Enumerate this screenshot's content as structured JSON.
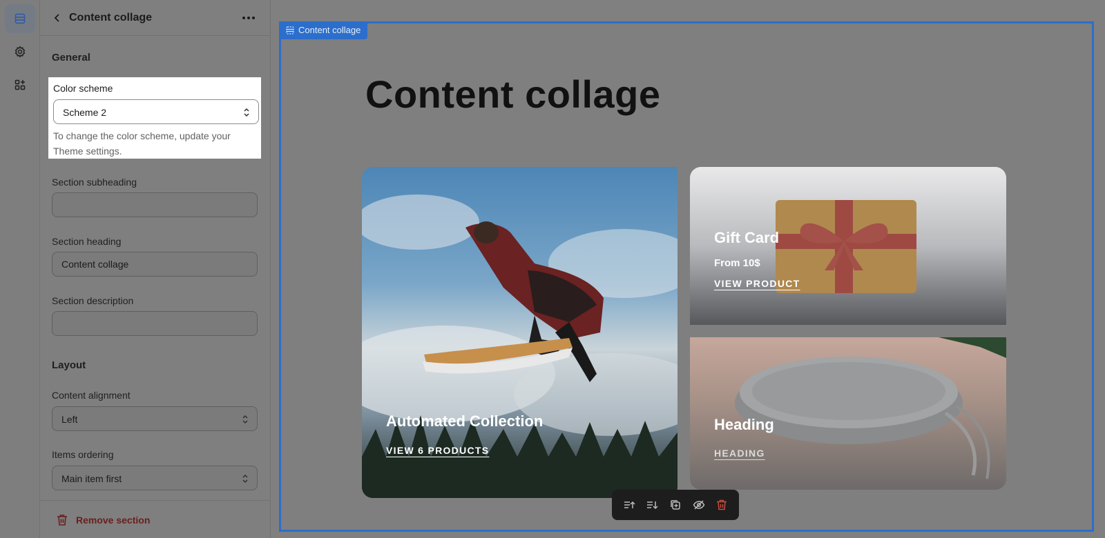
{
  "rail": {
    "items": [
      {
        "icon": "sections-icon",
        "active": true
      },
      {
        "icon": "gear-icon",
        "active": false
      },
      {
        "icon": "apps-icon",
        "active": false
      }
    ]
  },
  "panel": {
    "title": "Content collage",
    "general_heading": "General",
    "color_scheme": {
      "label": "Color scheme",
      "value": "Scheme 2",
      "help": "To change the color scheme, update your Theme settings."
    },
    "subheading": {
      "label": "Section subheading",
      "value": ""
    },
    "heading": {
      "label": "Section heading",
      "value": "Content collage"
    },
    "description": {
      "label": "Section description",
      "value": ""
    },
    "layout_heading": "Layout",
    "alignment": {
      "label": "Content alignment",
      "value": "Left"
    },
    "ordering": {
      "label": "Items ordering",
      "value": "Main item first"
    },
    "remove_label": "Remove section"
  },
  "preview": {
    "tag_label": "Content collage",
    "heading": "Content collage",
    "tiles": {
      "main": {
        "title": "Automated Collection",
        "link": "VIEW 6 PRODUCTS"
      },
      "gift": {
        "title": "Gift Card",
        "subtitle": "From 10$",
        "link": "VIEW PRODUCT"
      },
      "heading": {
        "title": "Heading",
        "link": "HEADING"
      }
    },
    "toolbar": [
      "move-up-icon",
      "move-down-icon",
      "duplicate-icon",
      "hide-icon",
      "delete-icon"
    ]
  },
  "colors": {
    "selection": "#2c6ecb",
    "danger": "#8e1f0b",
    "toolbar": "#1d1d1d"
  }
}
